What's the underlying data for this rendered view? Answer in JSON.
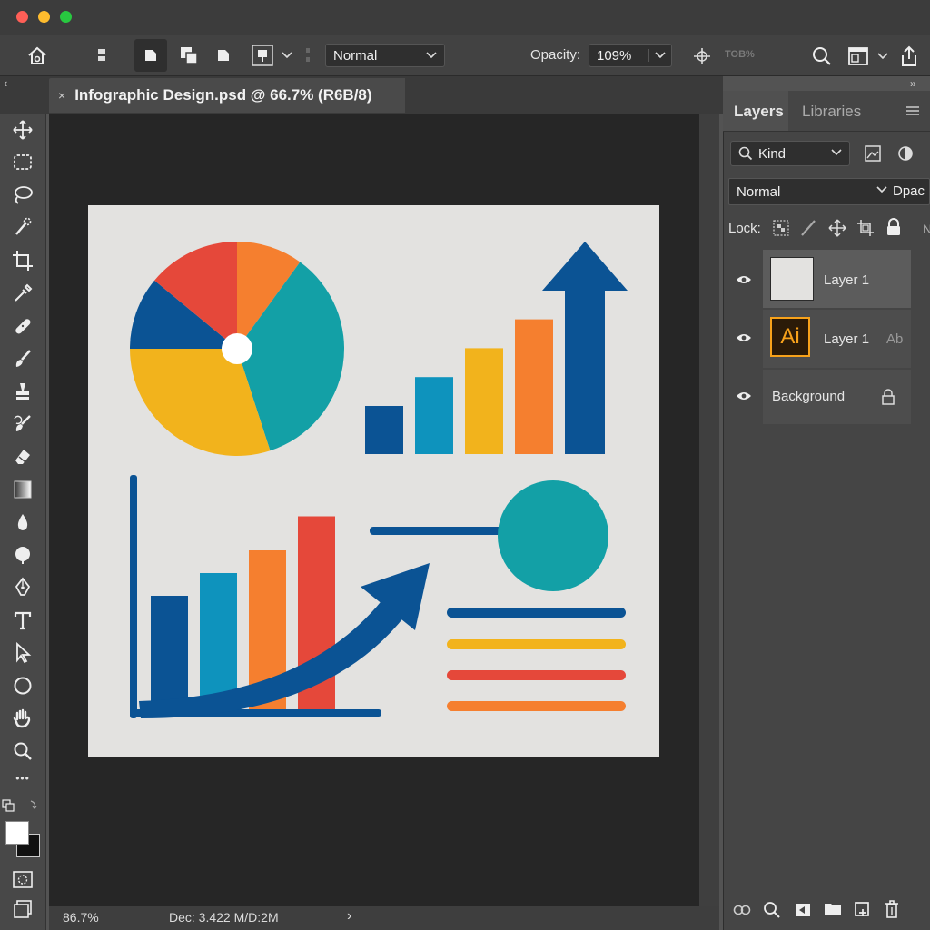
{
  "window": {
    "traffic_lights": {
      "close": "#ff5f57",
      "minimize": "#febc2e",
      "zoom": "#28c840"
    }
  },
  "options_bar": {
    "blend_mode": "Normal",
    "opacity_label": "Opacity:",
    "opacity_value": "109%",
    "faded_value": "TOB%"
  },
  "document": {
    "tab_title": "Infographic Design.psd @ 66.7% (R6B/8)",
    "close_glyph": "×"
  },
  "status": {
    "zoom": "86.7%",
    "doc_info": "Dec: 3.422 M/D:2M",
    "arrow": "›"
  },
  "panel": {
    "tabs": [
      "Layers",
      "Libraries"
    ],
    "filter_kind": "Kind",
    "blend_mode": "Normal",
    "opacity_label": "Dpac",
    "lock_label": "Lock:",
    "lock_extra": "N",
    "layers": [
      {
        "name": "Layer 1",
        "thumb": "blank",
        "visible": true
      },
      {
        "name": "Layer 1",
        "thumb": "Ai",
        "suffix": "Ab",
        "visible": true
      },
      {
        "name": "Background",
        "visible": true
      }
    ]
  },
  "toolbar": {
    "more_glyph": "•••"
  },
  "colors": {
    "blue_dark": "#0b5394",
    "teal": "#13a0a6",
    "cyan": "#0e93bd",
    "yellow": "#f2b31c",
    "orange": "#f57f2f",
    "red": "#e5483a",
    "artboard_bg": "#e3e2e0"
  },
  "chart_data": [
    {
      "type": "pie",
      "values": [
        10,
        35,
        30,
        11,
        14
      ],
      "colors": [
        "#f57f2f",
        "#13a0a6",
        "#f2b31c",
        "#0b5394",
        "#e5483a"
      ]
    },
    {
      "type": "bar",
      "categories": [
        "",
        "",
        "",
        ""
      ],
      "values": [
        1,
        1.6,
        2.2,
        2.8
      ],
      "colors": [
        "#0b5394",
        "#0e93bd",
        "#f2b31c",
        "#f57f2f"
      ]
    },
    {
      "type": "bar",
      "categories": [
        "",
        "",
        "",
        ""
      ],
      "values": [
        1,
        1.2,
        1.4,
        1.7
      ],
      "colors": [
        "#0b5394",
        "#0e93bd",
        "#f57f2f",
        "#e5483a"
      ]
    }
  ]
}
